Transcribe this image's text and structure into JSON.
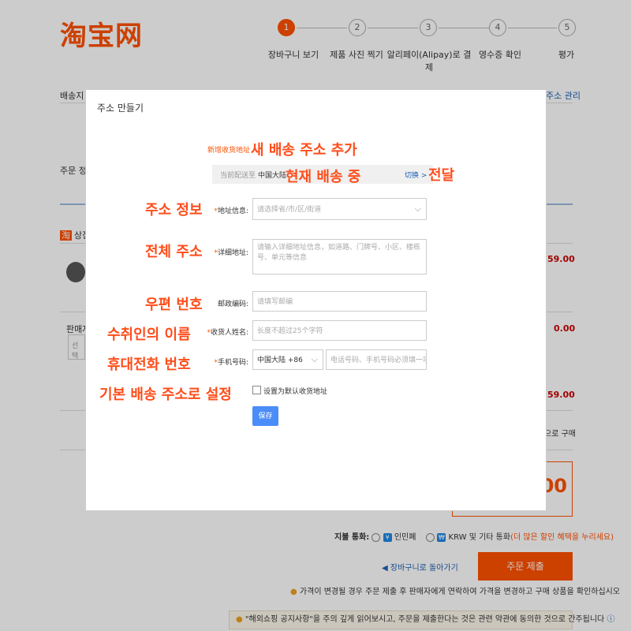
{
  "brand": {
    "logo": "淘宝网",
    "accent": "#ff5000"
  },
  "steps": [
    {
      "num": "1",
      "label": "장바구니 보기",
      "active": true
    },
    {
      "num": "2",
      "label": "제품 사진 찍기",
      "active": false
    },
    {
      "num": "3",
      "label": "알리페이(Alipay)로 결제",
      "active": false
    },
    {
      "num": "4",
      "label": "영수증 확인",
      "active": false
    },
    {
      "num": "5",
      "label": "평가",
      "active": false
    }
  ],
  "background": {
    "shipping_label": "배송지 :",
    "address_manage": "주소 관리",
    "order_label": "주문 정.",
    "shop_label": "상점:",
    "seller_label": "판매자",
    "select_label": "선택",
    "prices": [
      "59.00",
      "0.00",
      "59.00"
    ],
    "purchase_text": "으로 구매",
    "total_amount": ".00"
  },
  "payment": {
    "label": "지불 통화:",
    "rmb": "인민폐",
    "krw": "KRW 및 기타 통화",
    "krw_note": "(더 많은 할인 혜택을 누리세요)"
  },
  "actions": {
    "back_to_cart": "장바구니로 돌아가기",
    "submit": "주문 제출"
  },
  "notices": {
    "price_notice": "가격이 변경될 경우 주문 제출 후 판매자에게 연락하여 가격을 변경하고 구매 상품을 확인하십시오",
    "bottom_notice": "\"해외쇼핑 공지사항\"을 주의 깊게 읽어보시고, 주문을 제출한다는 것은 관련 약관에 동의한 것으로 간주됩니다"
  },
  "modal": {
    "title": "주소 만들기",
    "subtitle": "新增收货地址",
    "current_label": "当前配送至",
    "current_value": "中国大陆",
    "switch_label": "切换 >",
    "fields": {
      "region": {
        "label": "地址信息:",
        "placeholder": "请选择省/市/区/街道"
      },
      "detail": {
        "label": "详细地址:",
        "placeholder": "请输入详细地址信息，如道路、门牌号、小区、楼栋号、单元等信息"
      },
      "postal": {
        "label": "邮政编码:",
        "placeholder": "请填写邮编"
      },
      "name": {
        "label": "收货人姓名:",
        "placeholder": "长度不超过25个字符"
      },
      "phone": {
        "label": "手机号码:",
        "country": "中国大陆 +86",
        "placeholder": "电话号码、手机号码必须填一项"
      }
    },
    "default_label": "设置为默认收货地址",
    "save": "保存"
  },
  "annotations": {
    "new_address": "새 배송 주소 추가",
    "current_shipping": "현재 배송 중",
    "switch": "전달",
    "address_info": "주소 정보",
    "full_address": "전체 주소",
    "postal_code": "우편 번호",
    "recipient_name": "수취인의 이름",
    "mobile_number": "휴대전화 번호",
    "set_default": "기본 배송 주소로 설정"
  }
}
